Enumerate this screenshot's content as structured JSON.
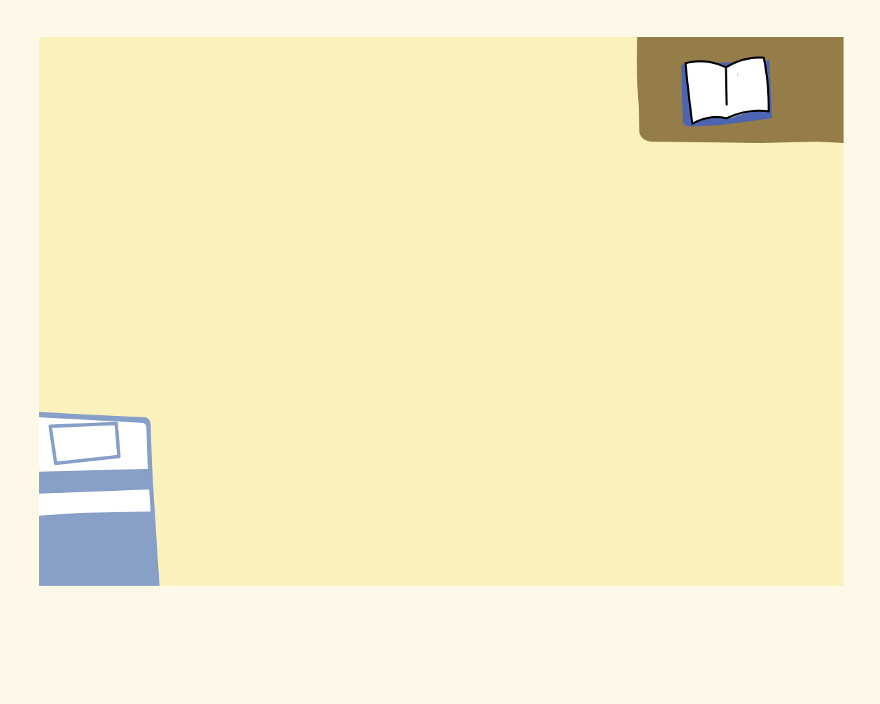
{
  "scene": {
    "name": "bedroom-top-down",
    "colors": {
      "page_background": "#fef8e8",
      "floor": "#fbf1bd",
      "desk": "#947d49",
      "book_pages": "#ffffff",
      "book_cover": "#4d64b0",
      "book_outline": "#000000",
      "bed_blanket": "#88a0c8",
      "bed_sheet": "#ffffff",
      "pillow_outline": "#88a0c8"
    },
    "objects": [
      {
        "id": "desk",
        "icon": "desk-icon",
        "interactable": true
      },
      {
        "id": "open-book",
        "icon": "book-icon",
        "interactable": true
      },
      {
        "id": "bed",
        "icon": "bed-icon",
        "interactable": true
      },
      {
        "id": "pillow",
        "icon": "pillow-icon",
        "interactable": true
      }
    ]
  }
}
